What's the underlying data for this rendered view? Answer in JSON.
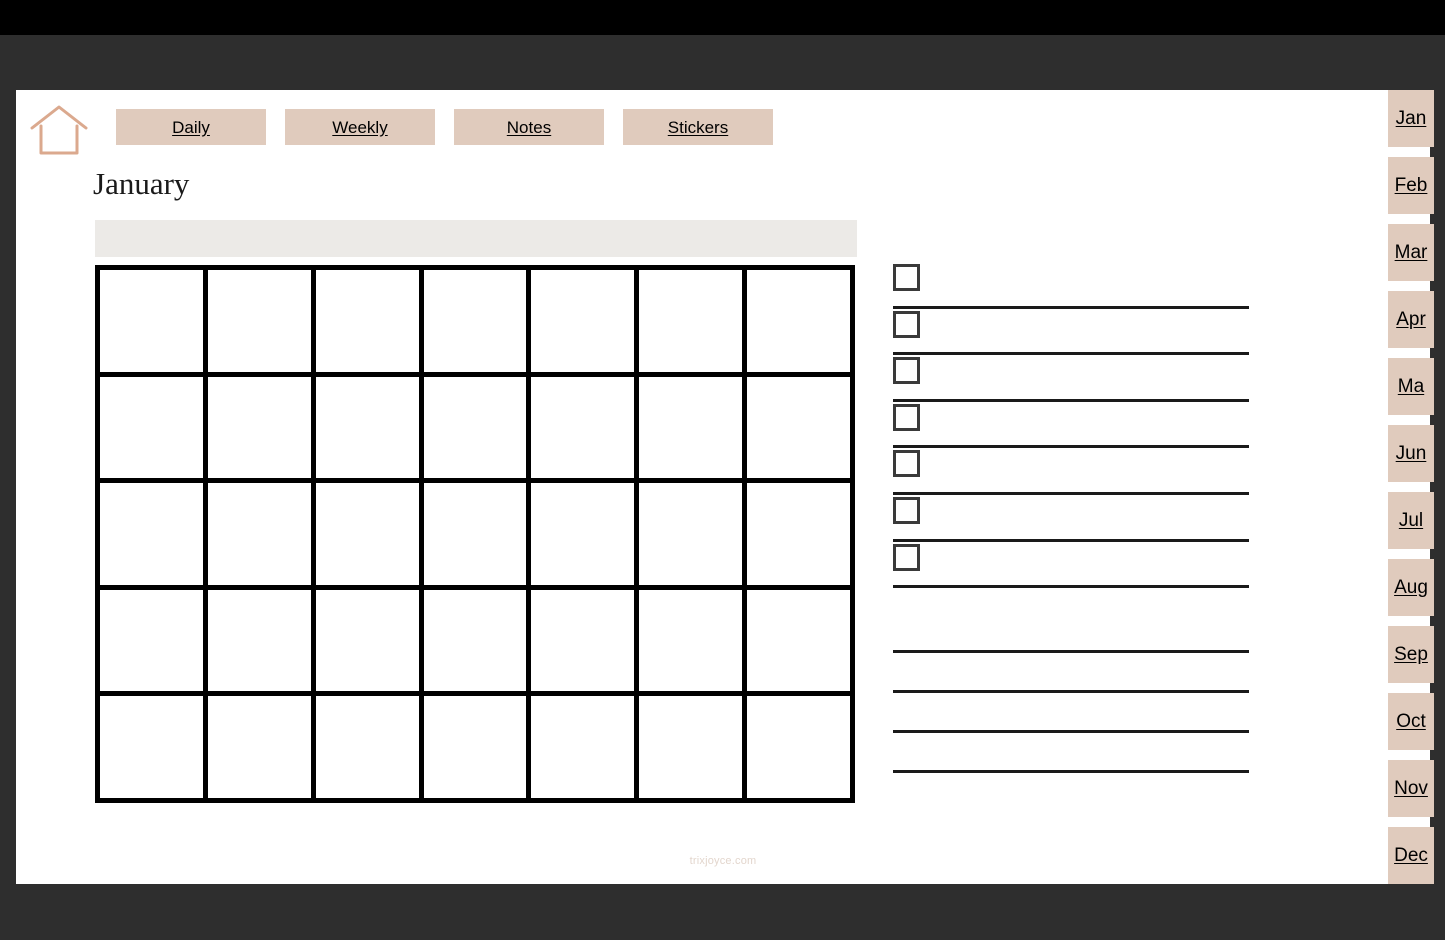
{
  "window": {
    "chrome_color": "#2e2e2e",
    "top_bar_color": "#000000",
    "page_background": "#ffffff"
  },
  "theme": {
    "accent": "#e0cbbd",
    "home_icon_stroke": "#dba98e",
    "header_bar": "#eceae7",
    "rule_color": "#1a1a1a",
    "watermark_color": "#e3d6cd"
  },
  "header": {
    "home_icon": "home-icon",
    "tabs": [
      {
        "label": "Daily"
      },
      {
        "label": "Weekly"
      },
      {
        "label": "Notes"
      },
      {
        "label": "Stickers"
      }
    ]
  },
  "main": {
    "month_title": "January",
    "calendar": {
      "weekday_header_labels": [
        "",
        "",
        "",
        "",
        "",
        "",
        ""
      ],
      "columns": 7,
      "rows": 5,
      "cells": [
        "",
        "",
        "",
        "",
        "",
        "",
        "",
        "",
        "",
        "",
        "",
        "",
        "",
        "",
        "",
        "",
        "",
        "",
        "",
        "",
        "",
        "",
        "",
        "",
        "",
        "",
        "",
        "",
        "",
        "",
        "",
        "",
        "",
        "",
        ""
      ]
    },
    "checklist": {
      "items": [
        {
          "checked": false,
          "text": ""
        },
        {
          "checked": false,
          "text": ""
        },
        {
          "checked": false,
          "text": ""
        },
        {
          "checked": false,
          "text": ""
        },
        {
          "checked": false,
          "text": ""
        },
        {
          "checked": false,
          "text": ""
        },
        {
          "checked": false,
          "text": ""
        }
      ]
    },
    "notes": {
      "lines": [
        "",
        "",
        "",
        ""
      ]
    }
  },
  "footer": {
    "watermark": "trixjoyce.com"
  },
  "month_rail": {
    "months": [
      {
        "label": "Jan"
      },
      {
        "label": "Feb"
      },
      {
        "label": "Mar"
      },
      {
        "label": "Apr"
      },
      {
        "label": "Ma"
      },
      {
        "label": "Jun"
      },
      {
        "label": "Jul"
      },
      {
        "label": "Aug"
      },
      {
        "label": "Sep"
      },
      {
        "label": "Oct"
      },
      {
        "label": "Nov"
      },
      {
        "label": "Dec"
      }
    ]
  }
}
